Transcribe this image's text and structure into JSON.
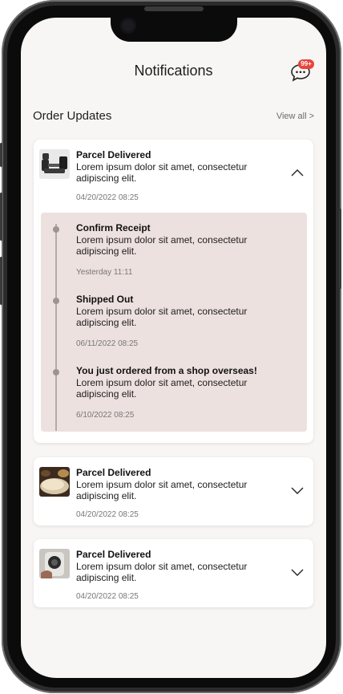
{
  "header": {
    "title": "Notifications",
    "badge": "99+"
  },
  "section": {
    "title": "Order Updates",
    "view_all": "View all >"
  },
  "cards": [
    {
      "title": "Parcel Delivered",
      "body": "Lorem ipsum dolor sit amet, consectetur adipiscing elit.",
      "time": "04/20/2022 08:25",
      "expanded": true,
      "timeline": [
        {
          "title": "Confirm Receipt",
          "body": "Lorem ipsum dolor sit amet, consectetur adipiscing elit.",
          "time": "Yesterday 11:11"
        },
        {
          "title": "Shipped Out",
          "body": "Lorem ipsum dolor sit amet, consectetur adipiscing elit.",
          "time": "06/11/2022 08:25"
        },
        {
          "title": "You just ordered from a shop overseas!",
          "body": "Lorem ipsum dolor sit amet, consectetur adipiscing elit.",
          "time": "6/10/2022 08:25"
        }
      ]
    },
    {
      "title": "Parcel Delivered",
      "body": "Lorem ipsum dolor sit amet, consectetur adipiscing elit.",
      "time": "04/20/2022 08:25",
      "expanded": false
    },
    {
      "title": "Parcel Delivered",
      "body": "Lorem ipsum dolor sit amet, consectetur adipiscing elit.",
      "time": "04/20/2022 08:25",
      "expanded": false
    }
  ],
  "icons": {
    "chat": "chat-bubble-icon",
    "collapse": "chevron-up-icon",
    "expand": "chevron-down-icon"
  },
  "colors": {
    "accent_badge": "#e8453c",
    "timeline_bg": "#ede1df",
    "screen_bg": "#f8f6f4"
  }
}
